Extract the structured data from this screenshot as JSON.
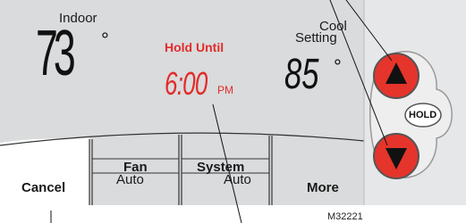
{
  "display": {
    "indoor_label": "Indoor",
    "indoor_temp": "73",
    "indoor_degree": "°",
    "hold_label": "Hold Until",
    "hold_time": "6:00",
    "hold_ampm": "PM",
    "cool_label": "Cool",
    "setting_label": "Setting",
    "setpoint": "85",
    "setpoint_degree": "°"
  },
  "soft_buttons": {
    "cancel": "Cancel",
    "fan_label": "Fan",
    "fan_value": "Auto",
    "system_label": "System",
    "system_value": "Auto",
    "more": "More"
  },
  "side_panel": {
    "up_icon": "triangle-up-icon",
    "down_icon": "triangle-down-icon",
    "hold_button": "HOLD"
  },
  "figure_id": "M32221",
  "colors": {
    "screen_bg": "#d9dbdc",
    "panel_bg": "#e6e7e8",
    "button_red": "#e5342b",
    "hold_red": "#e32b2b",
    "cancel_selected": "#ffffff"
  }
}
